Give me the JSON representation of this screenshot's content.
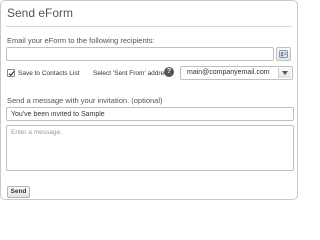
{
  "header": {
    "title": "Send eForm"
  },
  "recipients": {
    "label": "Email your eForm to the following recipients:",
    "value": "",
    "address_book_icon": "address-book-icon"
  },
  "options": {
    "save_to_contacts_label": "Save to Contacts List",
    "save_to_contacts_checked": true,
    "sent_from_label": "Select 'Sent From' address:",
    "info_glyph": "?",
    "sent_from_value": "main@companyemail.com"
  },
  "message": {
    "label": "Send a message with your invitation. (optional)",
    "subject_value": "You've been invited to Sample",
    "body_placeholder": "Enter a message."
  },
  "actions": {
    "send_label": "Send"
  }
}
